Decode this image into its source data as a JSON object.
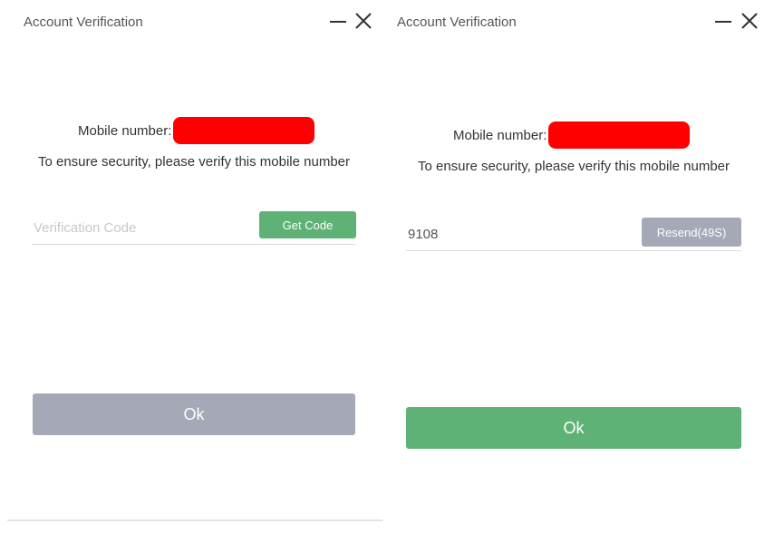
{
  "colors": {
    "green": "#5eb276",
    "gray_disabled": "#a4a8b7",
    "redaction": "#ff0000"
  },
  "left_dialog": {
    "title": "Account Verification",
    "minimize_icon": "minimize-icon",
    "close_icon": "close-icon",
    "mobile_label": "Mobile number:",
    "security_text": "To ensure security, please verify this mobile number",
    "code_input": {
      "value": "",
      "placeholder": "Verification Code"
    },
    "get_code_label": "Get Code",
    "ok_label": "Ok",
    "ok_state": "disabled"
  },
  "right_dialog": {
    "title": "Account Verification",
    "minimize_icon": "minimize-icon",
    "close_icon": "close-icon",
    "mobile_label": "Mobile number:",
    "security_text": "To ensure security, please verify this mobile number",
    "code_input": {
      "value": "9108",
      "placeholder": "Verification Code"
    },
    "resend_label": "Resend(49S)",
    "ok_label": "Ok",
    "ok_state": "enabled"
  }
}
